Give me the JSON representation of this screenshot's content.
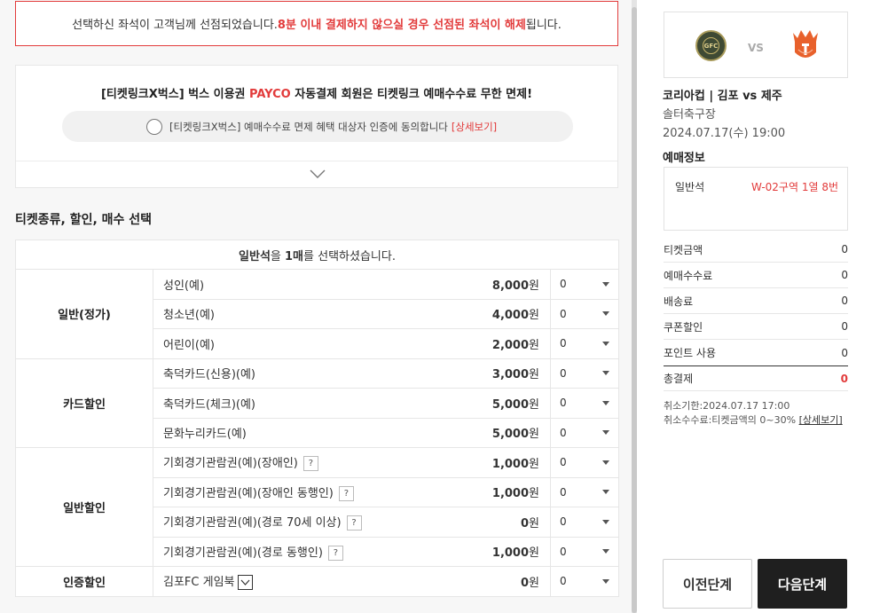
{
  "alert": {
    "prefix": "선택하신 좌석이 고객님께 선점되었습니다. ",
    "highlight": "8분 이내 결제하지 않으실 경우 선점된 좌석이 해제",
    "suffix": "됩니다."
  },
  "promo": {
    "title_prefix": "[티켓링크X벅스] 벅스 이용권 ",
    "title_brand": "PAYCO",
    "title_suffix": " 자동결제 회원은 티켓링크 예매수수료 무한 면제!",
    "agree_text": "[티켓링크X벅스] 예매수수료 면제 혜택 대상자 인증에 동의합니다",
    "agree_link": "[상세보기]"
  },
  "section_title": "티켓종류, 할인, 매수 선택",
  "table": {
    "notice_seat": "일반석",
    "notice_mid": "을 ",
    "notice_count": "1매",
    "notice_suffix": "를 선택하셨습니다.",
    "won": "원",
    "groups": [
      {
        "name": "일반(정가)",
        "rows": [
          {
            "label": "성인(예)",
            "price": "8,000",
            "qty": "0"
          },
          {
            "label": "청소년(예)",
            "price": "4,000",
            "qty": "0"
          },
          {
            "label": "어린이(예)",
            "price": "2,000",
            "qty": "0"
          }
        ]
      },
      {
        "name": "카드할인",
        "rows": [
          {
            "label": "축덕카드(신용)(예)",
            "price": "3,000",
            "qty": "0"
          },
          {
            "label": "축덕카드(체크)(예)",
            "price": "5,000",
            "qty": "0"
          },
          {
            "label": "문화누리카드(예)",
            "price": "5,000",
            "qty": "0"
          }
        ]
      },
      {
        "name": "일반할인",
        "rows": [
          {
            "label": "기회경기관람권(예)(장애인)",
            "price": "1,000",
            "qty": "0"
          },
          {
            "label": "기회경기관람권(예)(장애인 동행인)",
            "price": "1,000",
            "qty": "0"
          },
          {
            "label": "기회경기관람권(예)(경로 70세 이상)",
            "price": "0",
            "qty": "0"
          },
          {
            "label": "기회경기관람권(예)(경로 동행인)",
            "price": "1,000",
            "qty": "0"
          }
        ]
      },
      {
        "name": "인증할인",
        "rows": [
          {
            "label": "김포FC 게임북",
            "price": "0",
            "qty": "0"
          }
        ]
      }
    ],
    "help_mark": "?"
  },
  "sidebar": {
    "vs": "VS",
    "home_logo_text": "GFC",
    "match_title": "코리아컵 | 김포 vs 제주",
    "venue": "솔터축구장",
    "datetime": "2024.07.17(수) 19:00",
    "booking_label": "예매정보",
    "seat_type": "일반석",
    "seat_value": "W-02구역 1열 8번",
    "ticket_amount_label": "티켓금액",
    "ticket_amount": "0",
    "fee_label": "예매수수료",
    "fee": "0",
    "delivery_label": "배송료",
    "delivery": "0",
    "coupon_label": "쿠폰할인",
    "coupon": "0",
    "point_label": "포인트 사용",
    "point": "0",
    "total_label": "총결제",
    "total": "0",
    "cancel_deadline": "취소기한:2024.07.17 17:00",
    "cancel_fee": "취소수수료:티켓금액의 0~30% ",
    "cancel_link": "[상세보기]",
    "prev_button": "이전단계",
    "next_button": "다음단계"
  },
  "colors": {
    "accent_red": "#e23b3b",
    "dark_button": "#1f1f1f"
  }
}
